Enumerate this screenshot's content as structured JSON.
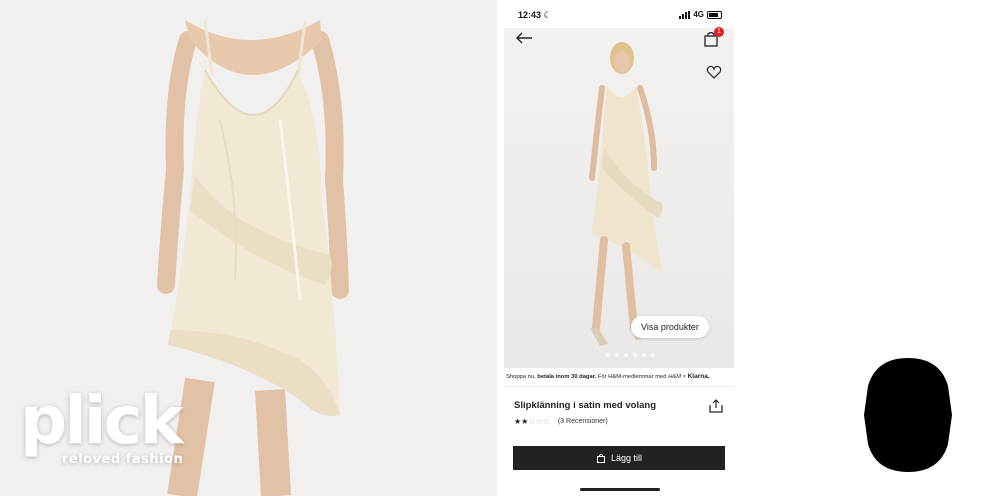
{
  "watermark": {
    "brand": "plick",
    "tagline": "reloved fashion"
  },
  "status_bar": {
    "time": "12:43",
    "network": "4G"
  },
  "cart": {
    "badge_count": "1"
  },
  "hero": {
    "show_products_label": "Visa produkter",
    "image_count": 6,
    "active_image_index": 0
  },
  "promo": {
    "prefix": "Shoppa nu, ",
    "bold": "betala inom 30 dagar.",
    "suffix": " För H&M-medlemmar med ",
    "hm_logo": "H&M",
    "separator": " × ",
    "klarna": "Klarna."
  },
  "product": {
    "title": "Slipklänning i satin med volang",
    "rating": 2,
    "rating_max": 5,
    "reviews_label": "(3 Recensioner)"
  },
  "add_to_cart_label": "Lägg till",
  "icons": {
    "back": "arrow-left-icon",
    "bag": "shopping-bag-icon",
    "favorite": "heart-icon",
    "share": "share-icon",
    "cart_button": "bag-icon",
    "moon": "moon-icon"
  },
  "colors": {
    "dress": "#f1e9d4",
    "button": "#222222",
    "badge": "#e02020"
  }
}
